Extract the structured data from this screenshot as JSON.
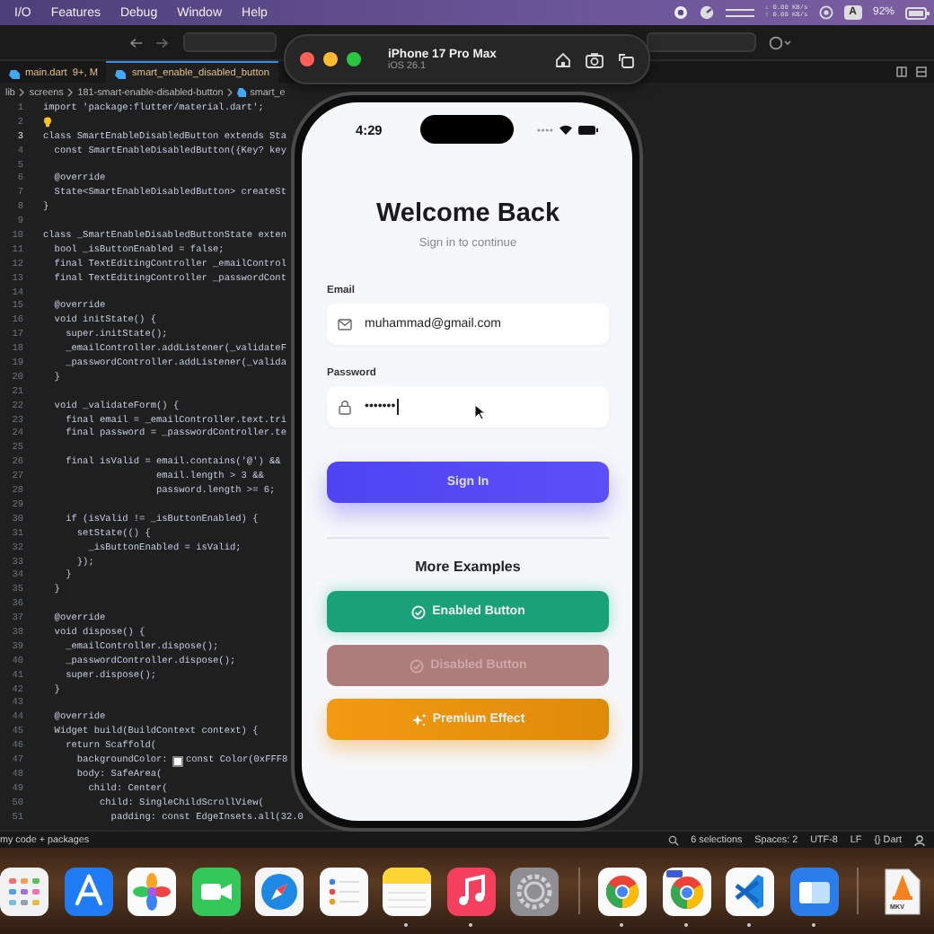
{
  "menu_bar": {
    "items": [
      "I/O",
      "Features",
      "Debug",
      "Window",
      "Help"
    ],
    "net_down": "↓ 0.00 KB/s",
    "net_up": "↑ 0.00 KB/s",
    "input_source": "A",
    "battery": "92%"
  },
  "editor": {
    "tabs": [
      {
        "label": "main.dart",
        "badge": "9+, M",
        "selected": false
      },
      {
        "label": "smart_enable_disabled_button",
        "selected": true
      }
    ],
    "breadcrumb": [
      "lib",
      "screens",
      "181-smart-enable-disabled-button",
      "smart_e"
    ],
    "lines": [
      {
        "n": "1",
        "text": "import 'package:flutter/material.dart';",
        "current": false
      },
      {
        "n": "2",
        "kind": "hint",
        "current": false
      },
      {
        "n": "3",
        "text": "class SmartEnableDisabledButton extends Sta",
        "current": true
      },
      {
        "n": "4",
        "text": "  const SmartEnableDisabledButton({Key? key",
        "current": false
      },
      {
        "n": "5",
        "current": false
      },
      {
        "n": "6",
        "text": "  @override",
        "current": false
      },
      {
        "n": "7",
        "text": "  State<SmartEnableDisabledButton> createSt",
        "current": false
      },
      {
        "n": "8",
        "text": "}",
        "current": false
      },
      {
        "n": "9",
        "current": false
      },
      {
        "n": "10",
        "text": "class _SmartEnableDisabledButtonState exten",
        "current": false
      },
      {
        "n": "11",
        "text": "  bool _isButtonEnabled = false;",
        "current": false
      },
      {
        "n": "12",
        "text": "  final TextEditingController _emailControl",
        "current": false
      },
      {
        "n": "13",
        "text": "  final TextEditingController _passwordCont",
        "current": false
      },
      {
        "n": "14",
        "current": false
      },
      {
        "n": "15",
        "text": "  @override",
        "current": false
      },
      {
        "n": "16",
        "text": "  void initState() {",
        "current": false
      },
      {
        "n": "17",
        "text": "    super.initState();",
        "current": false
      },
      {
        "n": "18",
        "text": "    _emailController.addListener(_validateF",
        "current": false
      },
      {
        "n": "19",
        "text": "    _passwordController.addListener(_valida",
        "current": false
      },
      {
        "n": "20",
        "text": "  }",
        "current": false
      },
      {
        "n": "21",
        "current": false
      },
      {
        "n": "22",
        "text": "  void _validateForm() {",
        "current": false
      },
      {
        "n": "23",
        "text": "    final email = _emailController.text.tri",
        "current": false
      },
      {
        "n": "24",
        "text": "    final password = _passwordController.te",
        "current": false
      },
      {
        "n": "25",
        "current": false
      },
      {
        "n": "26",
        "text": "    final isValid = email.contains('@') &&",
        "current": false
      },
      {
        "n": "27",
        "text": "                    email.length > 3 &&",
        "current": false
      },
      {
        "n": "28",
        "text": "                    password.length >= 6;",
        "current": false
      },
      {
        "n": "29",
        "current": false
      },
      {
        "n": "30",
        "text": "    if (isValid != _isButtonEnabled) {",
        "current": false
      },
      {
        "n": "31",
        "text": "      setState(() {",
        "current": false
      },
      {
        "n": "32",
        "text": "        _isButtonEnabled = isValid;",
        "current": false
      },
      {
        "n": "33",
        "text": "      });",
        "current": false
      },
      {
        "n": "34",
        "text": "    }",
        "current": false
      },
      {
        "n": "35",
        "text": "  }",
        "current": false
      },
      {
        "n": "36",
        "current": false
      },
      {
        "n": "37",
        "text": "  @override",
        "current": false
      },
      {
        "n": "38",
        "text": "  void dispose() {",
        "current": false
      },
      {
        "n": "39",
        "text": "    _emailController.dispose();",
        "current": false
      },
      {
        "n": "40",
        "text": "    _passwordController.dispose();",
        "current": false
      },
      {
        "n": "41",
        "text": "    super.dispose();",
        "current": false
      },
      {
        "n": "42",
        "text": "  }",
        "current": false
      },
      {
        "n": "43",
        "current": false
      },
      {
        "n": "44",
        "text": "  @override",
        "current": false
      },
      {
        "n": "45",
        "text": "  Widget build(BuildContext context) {",
        "current": false
      },
      {
        "n": "46",
        "text": "    return Scaffold(",
        "current": false
      },
      {
        "n": "47",
        "text": "      backgroundColor: ",
        "swatch": true,
        "rest": "const Color(0xFFF8",
        "current": false
      },
      {
        "n": "48",
        "text": "      body: SafeArea(",
        "current": false
      },
      {
        "n": "49",
        "text": "        child: Center(",
        "current": false
      },
      {
        "n": "50",
        "text": "          child: SingleChildScrollView(",
        "current": false
      },
      {
        "n": "51",
        "text": "            padding: const EdgeInsets.all(32.0",
        "current": false
      }
    ],
    "status_bar": {
      "left": "my code + packages",
      "items": [
        "6 selections",
        "Spaces: 2",
        "UTF-8",
        "LF",
        "{} Dart"
      ]
    }
  },
  "simulator": {
    "device": "iPhone 17 Pro Max",
    "os": "iOS 26.1"
  },
  "app": {
    "time": "4:29",
    "title": "Welcome Back",
    "subtitle": "Sign in to continue",
    "fields": [
      {
        "label": "Email",
        "kind": "email",
        "value": "muhammad@gmail.com",
        "focused": false
      },
      {
        "label": "Password",
        "kind": "password",
        "value": "•••••••",
        "focused": true
      }
    ],
    "sign_in": "Sign In",
    "section_title": "More Examples",
    "buttons": [
      {
        "kind": "enabled",
        "label": "Enabled Button",
        "disabled": false
      },
      {
        "kind": "disabled",
        "label": "Disabled Button",
        "disabled": true
      },
      {
        "kind": "premium",
        "label": "Premium Effect",
        "disabled": false
      }
    ]
  },
  "dock": [
    {
      "kind": "launcher",
      "running": false
    },
    {
      "kind": "store",
      "running": false
    },
    {
      "kind": "photos",
      "running": false
    },
    {
      "kind": "facetime",
      "running": false
    },
    {
      "kind": "safari",
      "running": false
    },
    {
      "kind": "reminders",
      "running": false
    },
    {
      "kind": "notes",
      "running": true
    },
    {
      "kind": "music",
      "running": true
    },
    {
      "kind": "settings",
      "running": false
    },
    {
      "kind": "separator"
    },
    {
      "kind": "chrome",
      "running": true
    },
    {
      "kind": "chrome_beta",
      "running": true
    },
    {
      "kind": "vscode",
      "running": true
    },
    {
      "kind": "window_app",
      "running": true
    },
    {
      "kind": "separator"
    },
    {
      "kind": "file",
      "label": "MKV"
    }
  ]
}
